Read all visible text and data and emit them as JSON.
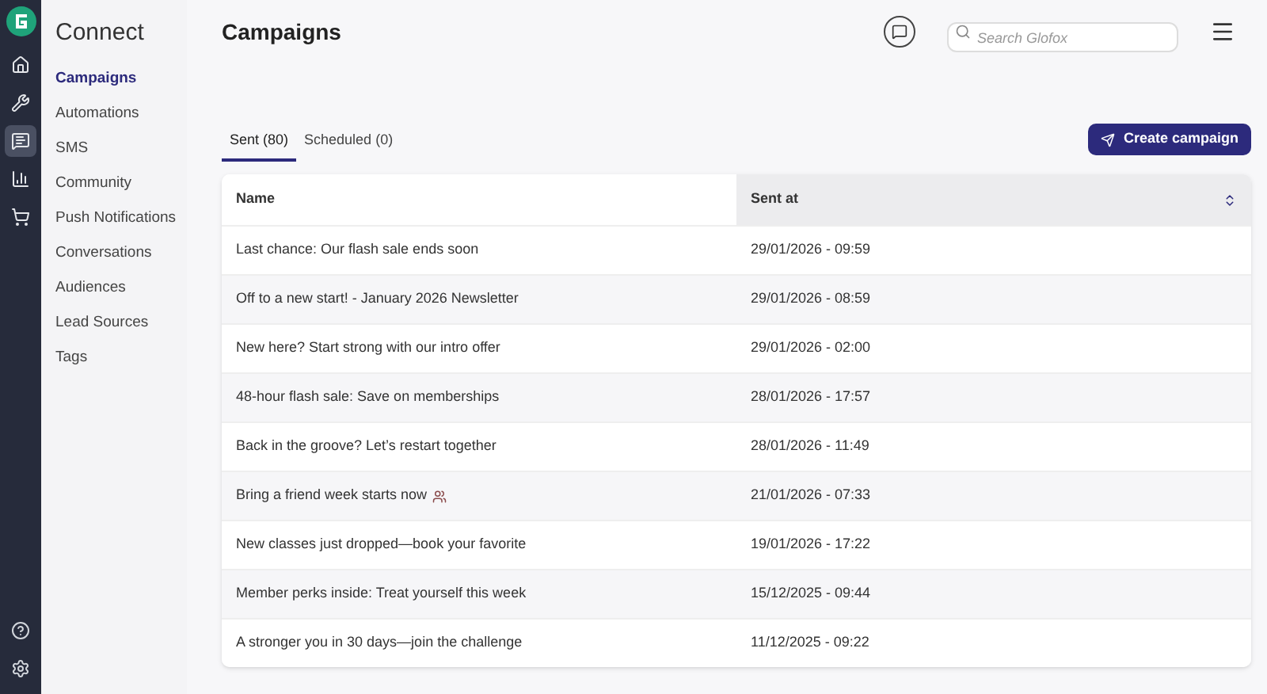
{
  "rail": {
    "items": [
      {
        "kind": "home",
        "selected": false
      },
      {
        "kind": "tools",
        "selected": false
      },
      {
        "kind": "connect",
        "selected": true
      },
      {
        "kind": "reports",
        "selected": false
      },
      {
        "kind": "store",
        "selected": false
      }
    ],
    "bottom": [
      {
        "kind": "help"
      },
      {
        "kind": "settings"
      }
    ]
  },
  "sidebar": {
    "title": "Connect",
    "items": [
      {
        "label": "Campaigns",
        "selected": true
      },
      {
        "label": "Automations",
        "selected": false
      },
      {
        "label": "SMS",
        "selected": false
      },
      {
        "label": "Community",
        "selected": false
      },
      {
        "label": "Push Notifications",
        "selected": false
      },
      {
        "label": "Conversations",
        "selected": false
      },
      {
        "label": "Audiences",
        "selected": false
      },
      {
        "label": "Lead Sources",
        "selected": false
      },
      {
        "label": "Tags",
        "selected": false
      }
    ]
  },
  "header": {
    "title": "Campaigns",
    "search": {
      "placeholder": "Search Glofox"
    }
  },
  "tabs": [
    {
      "label": "Sent (80)",
      "selected": true
    },
    {
      "label": "Scheduled (0)",
      "selected": false
    }
  ],
  "create_button": "Create campaign",
  "table": {
    "columns": [
      "Name",
      "Sent at"
    ],
    "rows": [
      [
        "Last chance: Our flash sale ends soon",
        "29/01/2026 - 09:59"
      ],
      [
        "Off to a new start! - January 2026 Newsletter",
        "29/01/2026 - 08:59"
      ],
      [
        "New here? Start strong with our intro offer",
        "29/01/2026 - 02:00"
      ],
      [
        "48-hour flash sale: Save on memberships",
        "28/01/2026 - 17:57"
      ],
      [
        "Back in the groove? Let’s restart together",
        "28/01/2026 - 11:49"
      ],
      [
        "Bring a friend week starts now",
        "21/01/2026 - 07:33"
      ],
      [
        "New classes just dropped—book your favorite",
        "19/01/2026 - 17:22"
      ],
      [
        "Member perks inside: Treat yourself this week",
        "15/12/2025 - 09:44"
      ],
      [
        "A stronger you in 30 days—join the challenge",
        "11/12/2025 - 09:22"
      ]
    ]
  }
}
